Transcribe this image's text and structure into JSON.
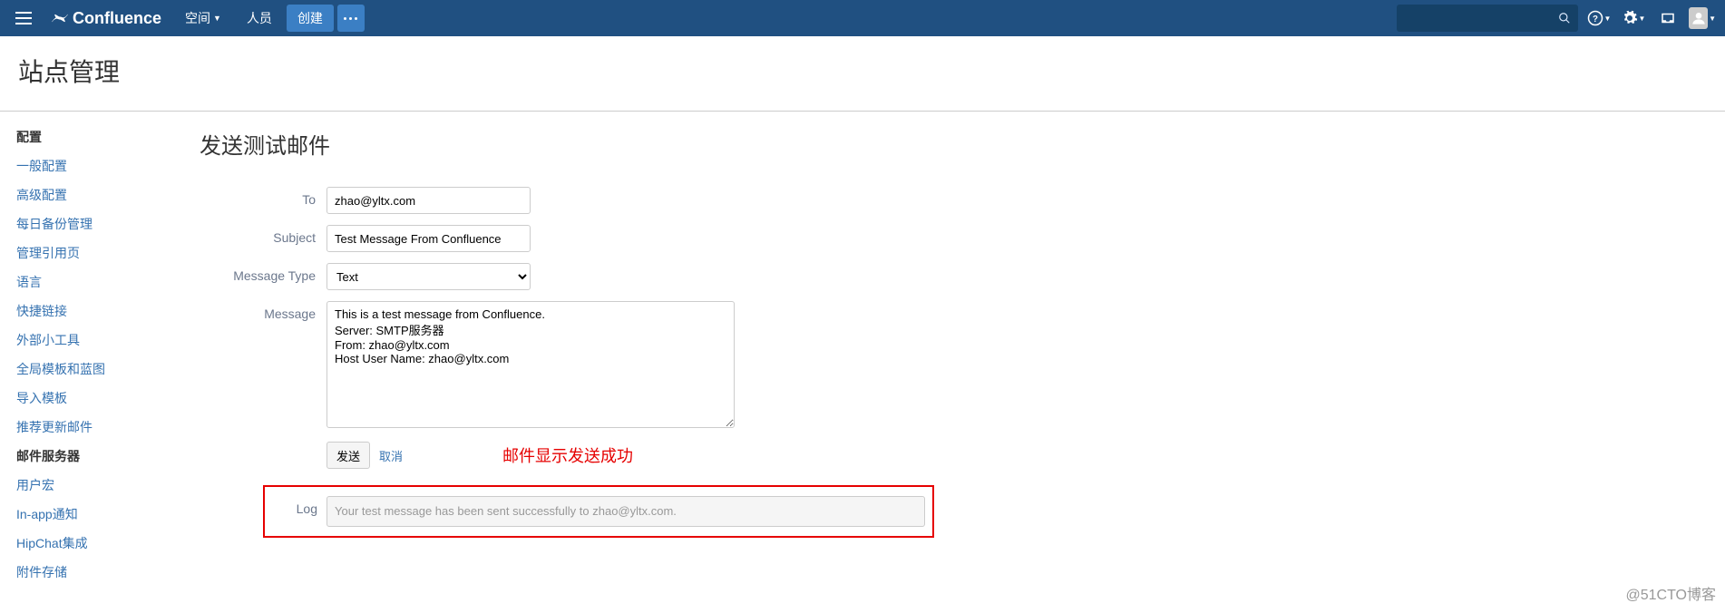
{
  "topnav": {
    "product": "Confluence",
    "links": {
      "spaces": "空间",
      "people": "人员"
    },
    "create": "创建"
  },
  "page_header": "站点管理",
  "sidebar": {
    "heading": "配置",
    "items": [
      {
        "label": "一般配置",
        "active": false
      },
      {
        "label": "高级配置",
        "active": false
      },
      {
        "label": "每日备份管理",
        "active": false
      },
      {
        "label": "管理引用页",
        "active": false
      },
      {
        "label": "语言",
        "active": false
      },
      {
        "label": "快捷链接",
        "active": false
      },
      {
        "label": "外部小工具",
        "active": false
      },
      {
        "label": "全局模板和蓝图",
        "active": false
      },
      {
        "label": "导入模板",
        "active": false
      },
      {
        "label": "推荐更新邮件",
        "active": false
      },
      {
        "label": "邮件服务器",
        "active": true
      },
      {
        "label": "用户宏",
        "active": false
      },
      {
        "label": "In-app通知",
        "active": false
      },
      {
        "label": "HipChat集成",
        "active": false
      },
      {
        "label": "附件存储",
        "active": false
      }
    ]
  },
  "main": {
    "title": "发送测试邮件",
    "labels": {
      "to": "To",
      "subject": "Subject",
      "message_type": "Message Type",
      "message": "Message",
      "log": "Log"
    },
    "values": {
      "to": "zhao@yltx.com",
      "subject": "Test Message From Confluence",
      "message_type": "Text",
      "message": "This is a test message from Confluence.\nServer: SMTP服务器\nFrom: zhao@yltx.com\nHost User Name: zhao@yltx.com"
    },
    "actions": {
      "send": "发送",
      "cancel": "取消"
    },
    "annotation": "邮件显示发送成功",
    "log": "Your test message has been sent successfully to zhao@yltx.com."
  },
  "watermark": "@51CTO博客"
}
